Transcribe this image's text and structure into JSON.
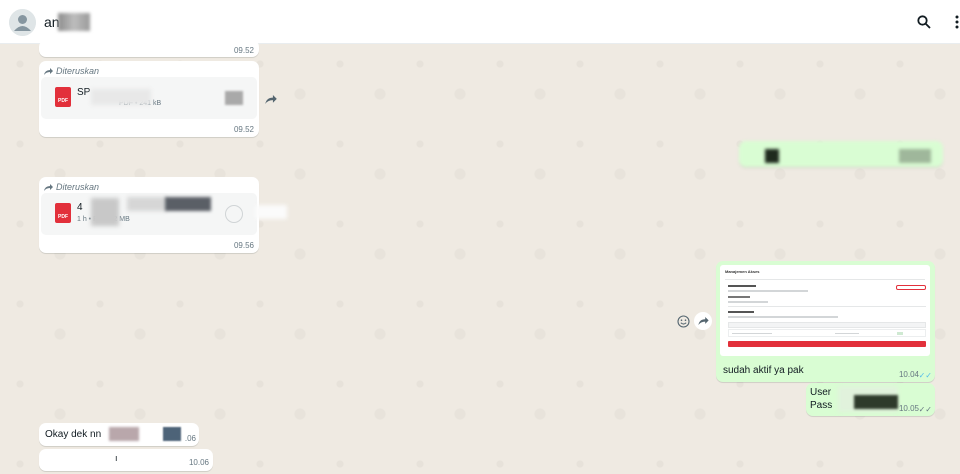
{
  "header": {
    "contact_name": "an",
    "search_icon": "search-icon",
    "menu_icon": "more-vertical-icon"
  },
  "messages": {
    "m1": {
      "time": "09.52"
    },
    "m2": {
      "forwarded_label": "Diteruskan",
      "doc_title": "SP",
      "doc_meta": "PDF • 241 kB",
      "time": "09.52"
    },
    "m3": {
      "forwarded_label": "Diteruskan",
      "doc_title": "4",
      "doc_meta": "1 h • PDF • 2 MB",
      "time": "09.56"
    },
    "m5": {
      "preview_title": "Manajemen Akses",
      "text": "sudah aktif ya pak",
      "time": "10.04"
    },
    "m6": {
      "line1": "User",
      "line2": "Pass",
      "time": "10.05"
    },
    "m7": {
      "text": "Okay dek nn",
      "time": ".06"
    },
    "m8": {
      "text": "ı",
      "time": "10.06"
    }
  },
  "colors": {
    "outgoing": "#d9fdd3",
    "incoming": "#ffffff",
    "background": "#efeae2",
    "pdf": "#e2303b"
  }
}
